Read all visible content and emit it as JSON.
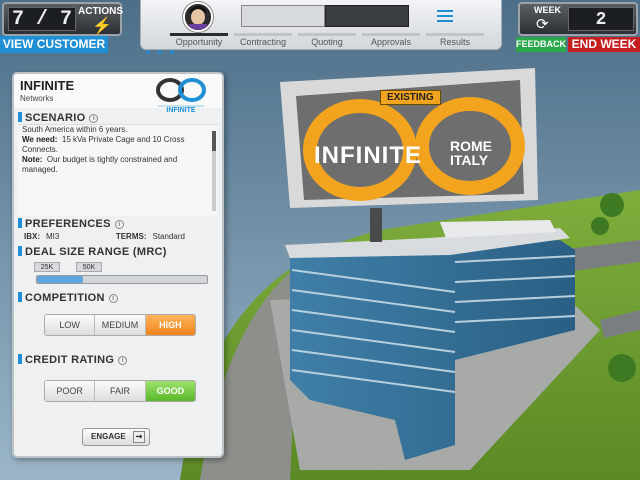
{
  "hud": {
    "actions": {
      "count": "7 / 7",
      "label": "ACTIONS",
      "icon": "lightning-bolt-icon"
    },
    "view_customer_label": "VIEW CUSTOMER",
    "deal_stages": [
      {
        "label": "Opportunity",
        "active": true
      },
      {
        "label": "Contracting",
        "active": false
      },
      {
        "label": "Quoting",
        "active": false
      },
      {
        "label": "Approvals",
        "active": false
      },
      {
        "label": "Results",
        "active": false
      }
    ],
    "week": {
      "label": "WEEK",
      "value": "2",
      "icon": "cycle-icon"
    },
    "feedback_label": "FEEDBACK",
    "end_week_label": "END WEEK"
  },
  "customer": {
    "company": "INFINITE",
    "industry": "Networks",
    "logo_text": "INFINITE",
    "scenario": {
      "title": "SCENARIO",
      "lead_line": "South America within 6 years.",
      "need_label": "We need:",
      "need_text": "15 kVa Private Cage and 10 Cross Connects.",
      "note_label": "Note:",
      "note_text": "Our budget is tightly constrained and managed."
    },
    "preferences": {
      "title": "PREFERENCES",
      "ibx_label": "IBX:",
      "ibx_value": "MI3",
      "terms_label": "TERMS:",
      "terms_value": "Standard"
    },
    "deal_size": {
      "title": "DEAL SIZE RANGE (MRC)",
      "ticks": [
        "25K",
        "50K"
      ],
      "fill_fraction": 0.27
    },
    "competition": {
      "title": "COMPETITION",
      "options": [
        "LOW",
        "MEDIUM",
        "HIGH"
      ],
      "selected": "HIGH"
    },
    "credit_rating": {
      "title": "CREDIT RATING",
      "options": [
        "POOR",
        "FAIR",
        "GOOD"
      ],
      "selected": "GOOD"
    },
    "engage_label": "ENGAGE"
  },
  "billboard": {
    "badge": "EXISTING",
    "brand": "INFINITE",
    "city": "ROME",
    "country": "ITALY"
  },
  "colors": {
    "accent_blue": "#1f8fd6",
    "end_week_red": "#c41e1e",
    "feedback_green": "#2aa84a",
    "competition_high_orange": "#f0841b",
    "credit_good_green": "#59b82a",
    "billboard_orange": "#f3a41e"
  }
}
